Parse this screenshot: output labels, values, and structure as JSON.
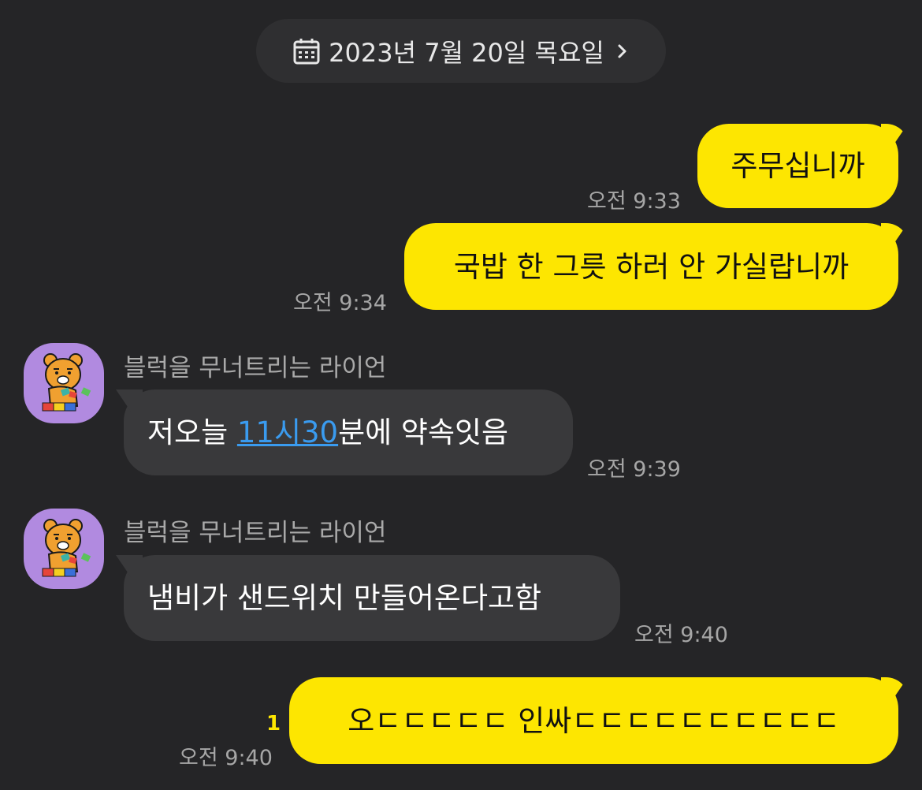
{
  "date_header": {
    "label": "2023년 7월 20일 목요일",
    "icon": "calendar-icon",
    "chevron": "chevron-right-icon"
  },
  "messages": [
    {
      "text": "주무십니까",
      "time": "오전 9:33"
    },
    {
      "text": "국밥 한 그릇 하러 안 가실랍니까",
      "time": "오전 9:34"
    },
    {
      "sender": "블럭을 무너트리는 라이언",
      "before_link": "저오늘 ",
      "link": "11시30",
      "after_link": "분에 약속잇음",
      "time": "오전 9:39"
    },
    {
      "sender": "블럭을 무너트리는 라이언",
      "text": "냄비가 샌드위치 만들어온다고함",
      "time": "오전 9:40"
    },
    {
      "text": "오ㄷㄷㄷㄷㄷ 인싸ㄷㄷㄷㄷㄷㄷㄷㄷㄷㄷ",
      "time": "오전 9:40",
      "unread": "1"
    }
  ],
  "colors": {
    "background": "#252527",
    "my_bubble": "#fde601",
    "other_bubble": "#39393b",
    "link": "#3a9bef"
  }
}
